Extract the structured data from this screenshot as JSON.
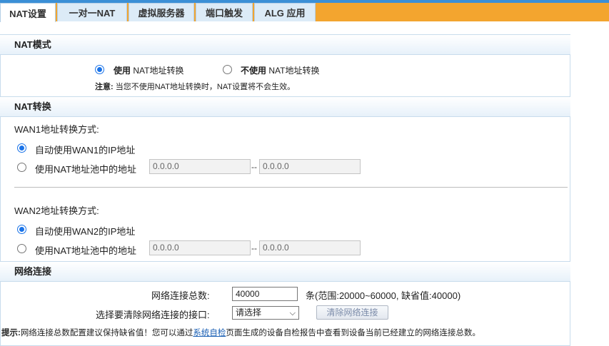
{
  "tabs": [
    {
      "label": "NAT设置"
    },
    {
      "label": "一对一NAT"
    },
    {
      "label": "虚拟服务器"
    },
    {
      "label": "端口触发"
    },
    {
      "label": "ALG 应用"
    }
  ],
  "nat_mode": {
    "title": "NAT模式",
    "use_bold": "使用",
    "use_rest": "NAT地址转换",
    "nouse_bold": "不使用",
    "nouse_rest": "NAT地址转换",
    "note_bold": "注意:",
    "note_text": "当您不使用NAT地址转换时，NAT设置将不会生效。"
  },
  "nat_conv": {
    "title": "NAT转换",
    "wan1": {
      "label": "WAN1地址转换方式:",
      "auto": "自动使用WAN1的IP地址",
      "pool": "使用NAT地址池中的地址",
      "from": "0.0.0.0",
      "sep": "--",
      "to": "0.0.0.0"
    },
    "wan2": {
      "label": "WAN2地址转换方式:",
      "auto": "自动使用WAN2的IP地址",
      "pool": "使用NAT地址池中的地址",
      "from": "0.0.0.0",
      "sep": "--",
      "to": "0.0.0.0"
    }
  },
  "net_conn": {
    "title": "网络连接",
    "total_label": "网络连接总数:",
    "total_value": "40000",
    "total_hint": "条(范围:20000~60000, 缺省值:40000)",
    "iface_label": "选择要清除网络连接的接口:",
    "iface_selected": "请选择",
    "clear_button": "清除网络连接",
    "tip_bold": "提示:",
    "tip_before": "网络连接总数配置建议保持缺省值！您可以通过",
    "tip_link": "系统自检",
    "tip_after": "页面生成的设备自检报告中查看到设备当前已经建立的网络连接总数。"
  }
}
